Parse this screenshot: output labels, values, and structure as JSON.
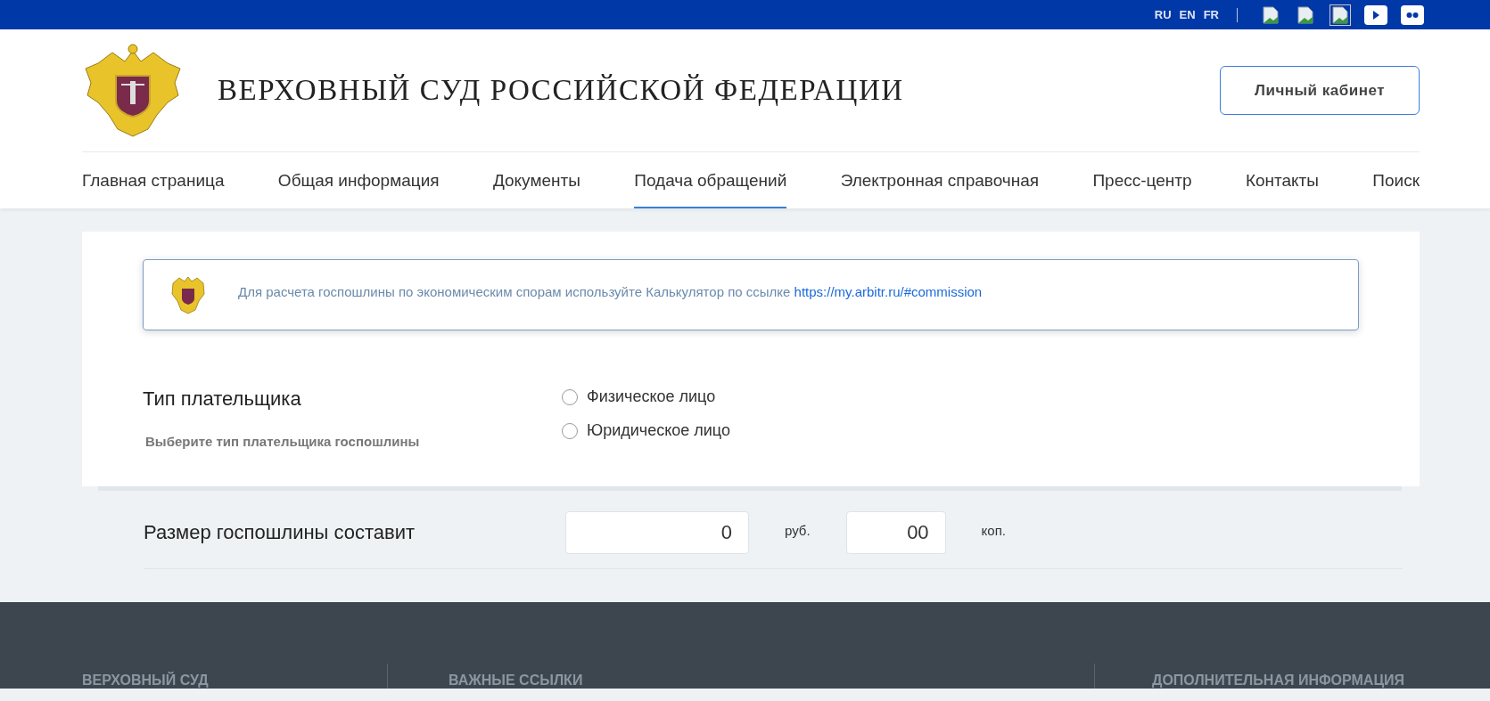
{
  "top_bar": {
    "languages": [
      "RU",
      "EN",
      "FR"
    ],
    "social_icons": [
      {
        "kind": "broken"
      },
      {
        "kind": "broken"
      },
      {
        "kind": "broken-framed"
      },
      {
        "kind": "play"
      },
      {
        "kind": "dots"
      }
    ]
  },
  "header": {
    "title": "ВЕРХОВНЫЙ СУД РОССИЙСКОЙ ФЕДЕРАЦИИ",
    "account_button": "Личный кабинет"
  },
  "nav": [
    {
      "label": "Главная страница",
      "selected": false
    },
    {
      "label": "Общая информация",
      "selected": false
    },
    {
      "label": "Документы",
      "selected": false
    },
    {
      "label": "Подача обращений",
      "selected": true
    },
    {
      "label": "Электронная справочная",
      "selected": false
    },
    {
      "label": "Пресс-центр",
      "selected": false
    },
    {
      "label": "Контакты",
      "selected": false
    },
    {
      "label": "Поиск",
      "selected": false
    }
  ],
  "notice": {
    "text": "Для расчета госпошлины по экономическим спорам используйте Калькулятор по ссылке",
    "link": "https://my.arbitr.ru/#commission"
  },
  "payer_type": {
    "label": "Тип плательщика",
    "hint": "Выберите тип плательщика госпошлины",
    "options": [
      {
        "label": "Физическое лицо",
        "selected": false
      },
      {
        "label": "Юридическое лицо",
        "selected": false
      }
    ]
  },
  "fee": {
    "label": "Размер госпошлины составит",
    "rubles": "0",
    "rubles_unit": "руб.",
    "kopecks": "00",
    "kopecks_unit": "коп."
  },
  "footer": {
    "columns": [
      "ВЕРХОВНЫЙ СУД",
      "ВАЖНЫЕ ССЫЛКИ",
      "ДОПОЛНИТЕЛЬНАЯ ИНФОРМАЦИЯ"
    ]
  }
}
